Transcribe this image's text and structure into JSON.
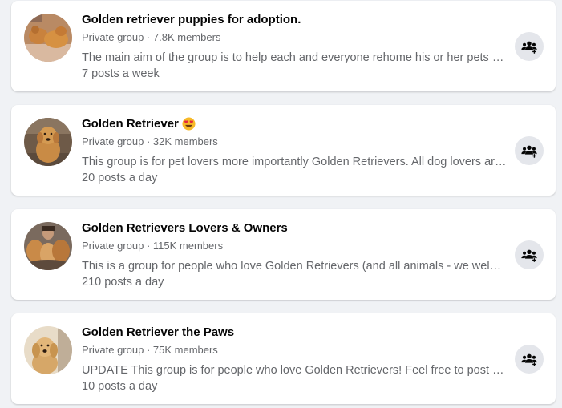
{
  "groups": [
    {
      "name": "Golden retriever puppies for adoption.",
      "privacy": "Private group",
      "members": "7.8K members",
      "description": "The main aim of the group is to help each and everyone rehome his or her pets and also get those who are looking for pets to adopt or buy them",
      "activity": "7 posts a week",
      "has_emoji": false
    },
    {
      "name": "Golden Retriever",
      "privacy": "Private group",
      "members": "32K members",
      "description": "This group is for pet lovers more importantly Golden Retrievers. All dog lovers are welcome",
      "activity": "20 posts a day",
      "has_emoji": true,
      "emoji_icon": "heart-eyes-emoji-icon"
    },
    {
      "name": "Golden Retrievers Lovers & Owners",
      "privacy": "Private group",
      "members": "115K members",
      "description": "This is a group for people who love Golden Retrievers (and all animals - we welcome all pet lovers)",
      "activity": "210 posts a day",
      "has_emoji": false
    },
    {
      "name": "Golden Retriever the Paws",
      "privacy": "Private group",
      "members": "75K members",
      "description": "UPDATE This group is for people who love Golden Retrievers! Feel free to post pictures of your dogs",
      "activity": "10 posts a day",
      "has_emoji": false
    }
  ],
  "separator": " · ",
  "icons": {
    "join": "group-join-icon",
    "avatar": "group-avatar-photo"
  },
  "colors": {
    "background": "#f0f2f5",
    "card": "#ffffff",
    "title": "#050505",
    "secondary_text": "#65676b",
    "button_bg": "#e4e6eb",
    "icon": "#050505"
  }
}
